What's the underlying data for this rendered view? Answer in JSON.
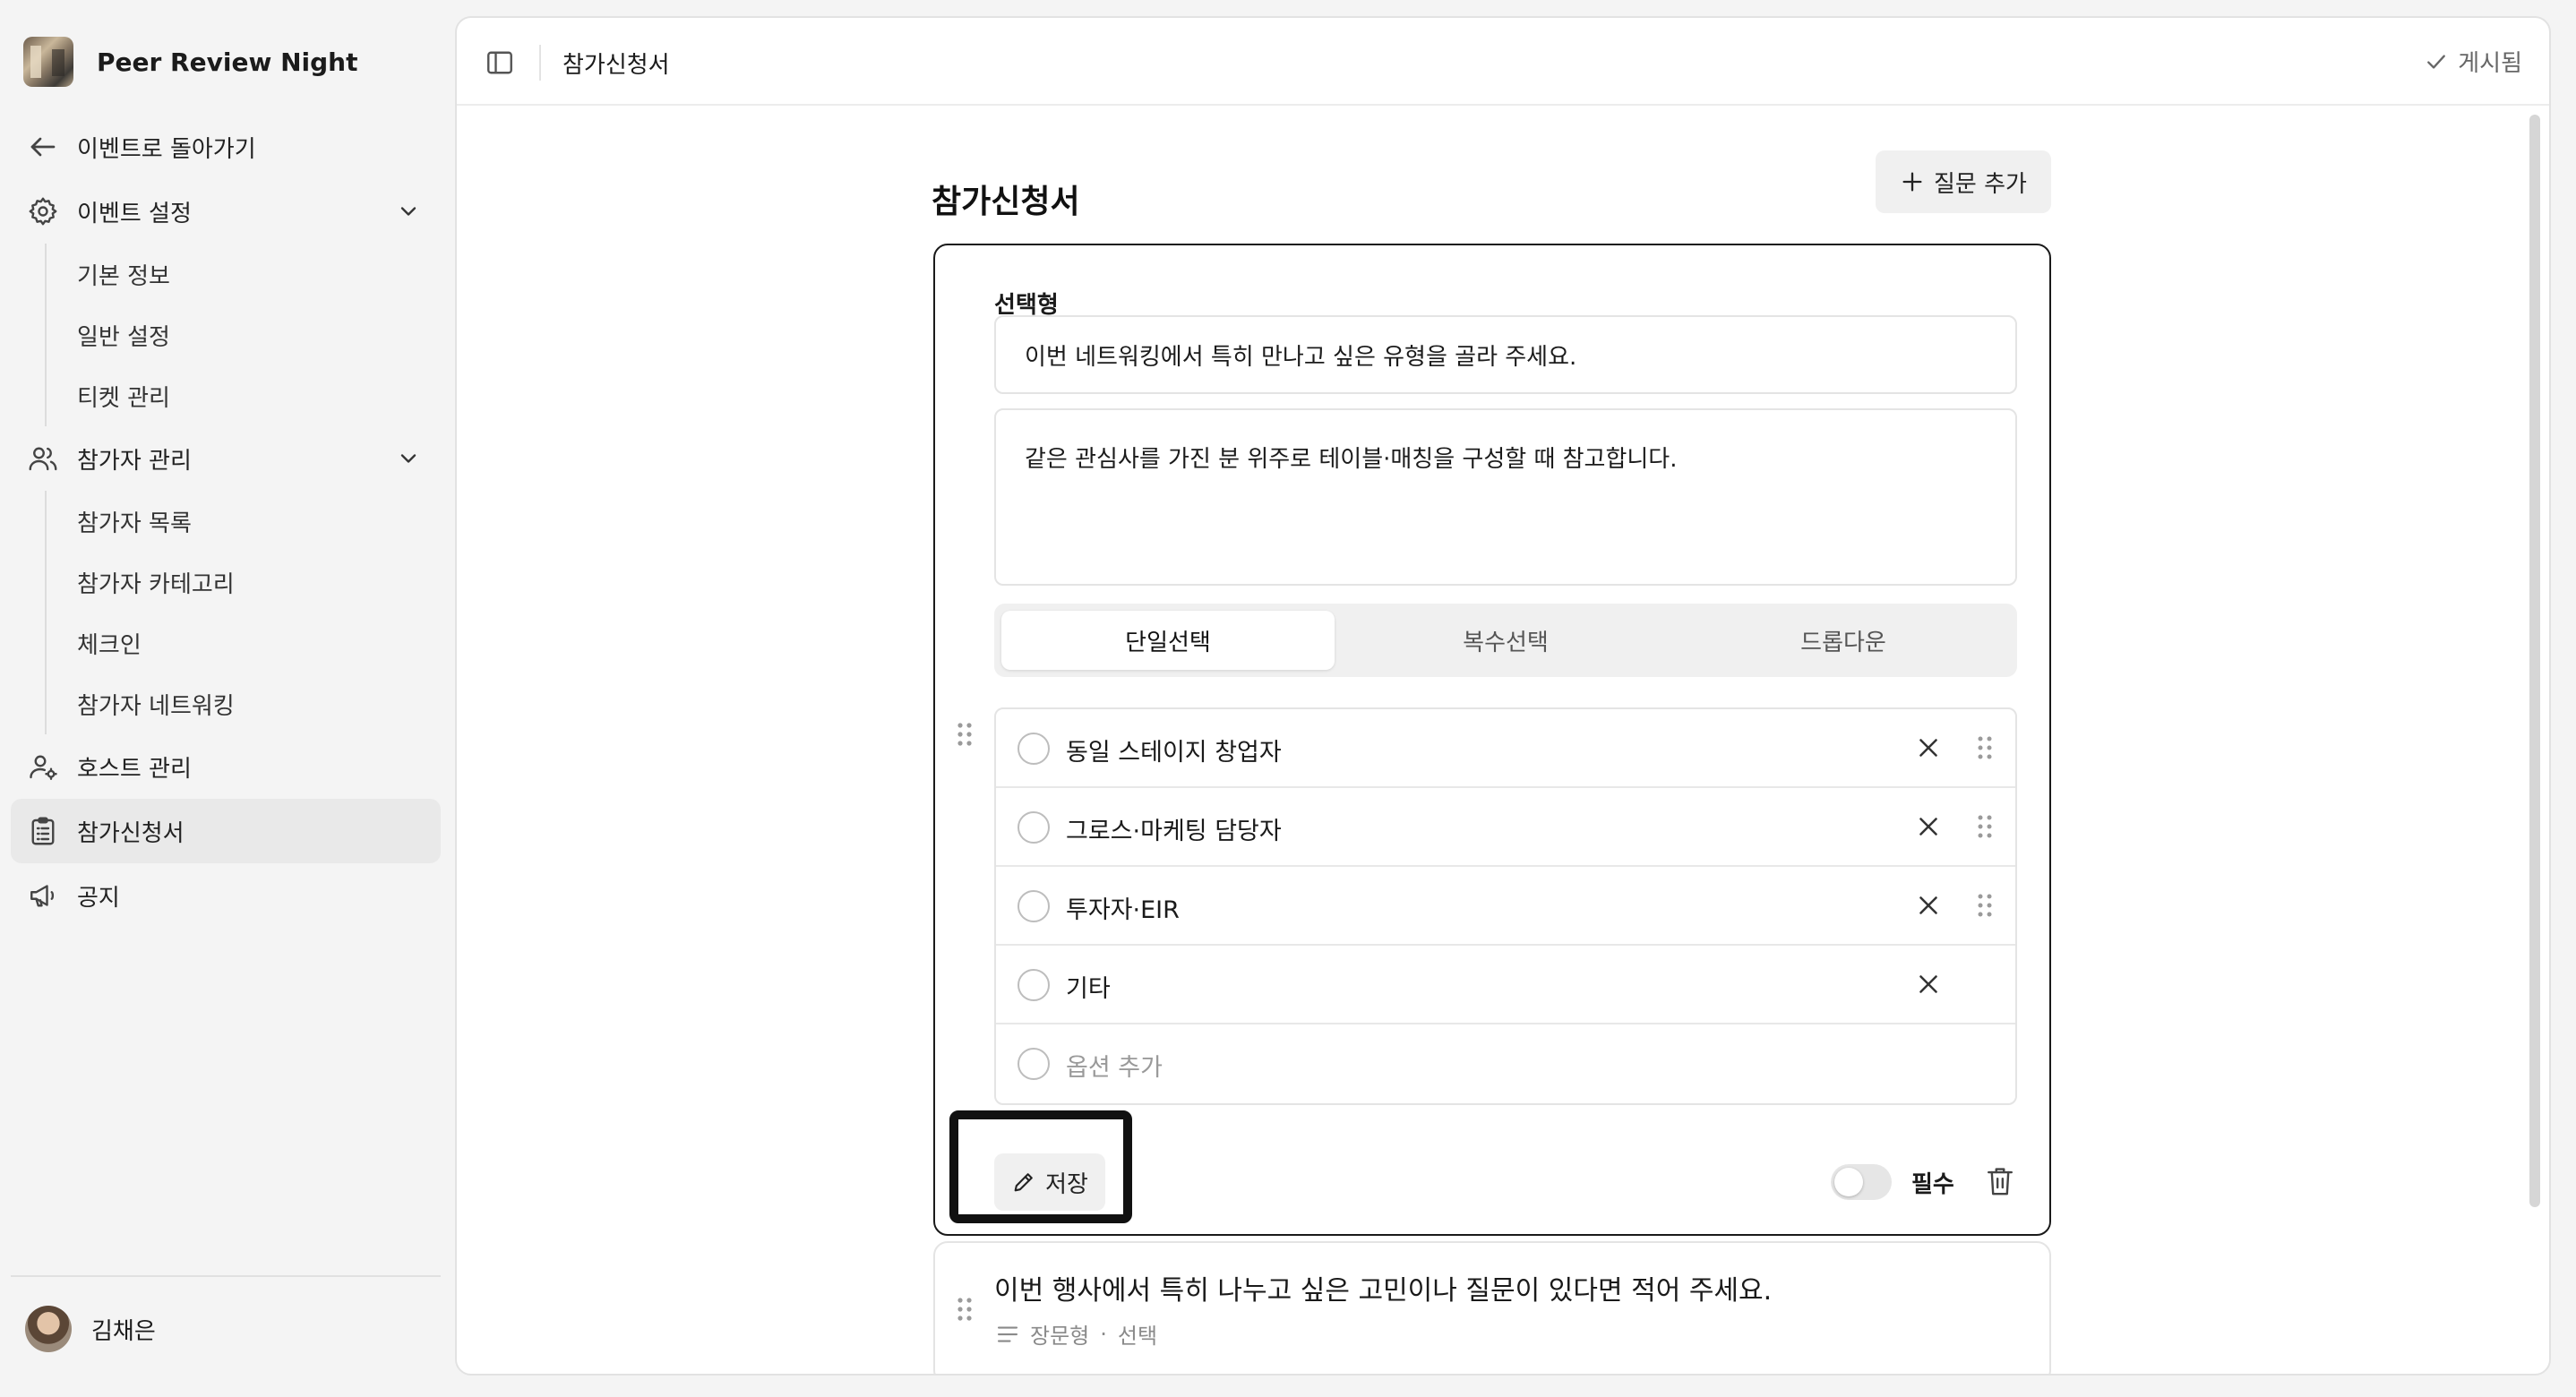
{
  "brand": {
    "name": "Peer Review Night"
  },
  "nav": {
    "back_label": "이벤트로 돌아가기",
    "event_settings": {
      "label": "이벤트 설정",
      "items": [
        "기본 정보",
        "일반 설정",
        "티켓 관리"
      ]
    },
    "participants": {
      "label": "참가자 관리",
      "items": [
        "참가자 목록",
        "참가자 카테고리",
        "체크인",
        "참가자 네트워킹"
      ]
    },
    "hosts_label": "호스트 관리",
    "application_label": "참가신청서",
    "notice_label": "공지"
  },
  "user": {
    "name": "김채은"
  },
  "topbar": {
    "title": "참가신청서",
    "status": "게시됨"
  },
  "page": {
    "title": "참가신청서",
    "add_question_label": "질문 추가"
  },
  "question": {
    "type_label": "선택형",
    "title": "이번 네트워킹에서 특히 만나고 싶은 유형을 골라 주세요.",
    "description": "같은 관심사를 가진 분 위주로 테이블·매칭을 구성할 때 참고합니다.",
    "modes": [
      "단일선택",
      "복수선택",
      "드롭다운"
    ],
    "active_mode": "단일선택",
    "options": [
      "동일 스테이지 창업자",
      "그로스·마케팅 담당자",
      "투자자·EIR",
      "기타"
    ],
    "add_option_placeholder": "옵션 추가",
    "save_label": "저장",
    "required_label": "필수",
    "required": false
  },
  "question2": {
    "title": "이번 행사에서 특히 나누고 싶은 고민이나 질문이 있다면 적어 주세요.",
    "type": "장문형",
    "required_text": "선택"
  },
  "icons": {
    "back": "arrow-left-icon",
    "settings": "gear-icon",
    "participants": "users-icon",
    "hosts": "user-gear-icon",
    "application": "clipboard-list-icon",
    "notice": "megaphone-icon",
    "panel": "sidebar-toggle-icon",
    "check": "check-icon",
    "plus": "plus-icon",
    "pencil": "pencil-icon",
    "close": "close-icon",
    "drag": "drag-handle-icon",
    "trash": "trash-icon",
    "long_text": "long-text-icon"
  }
}
